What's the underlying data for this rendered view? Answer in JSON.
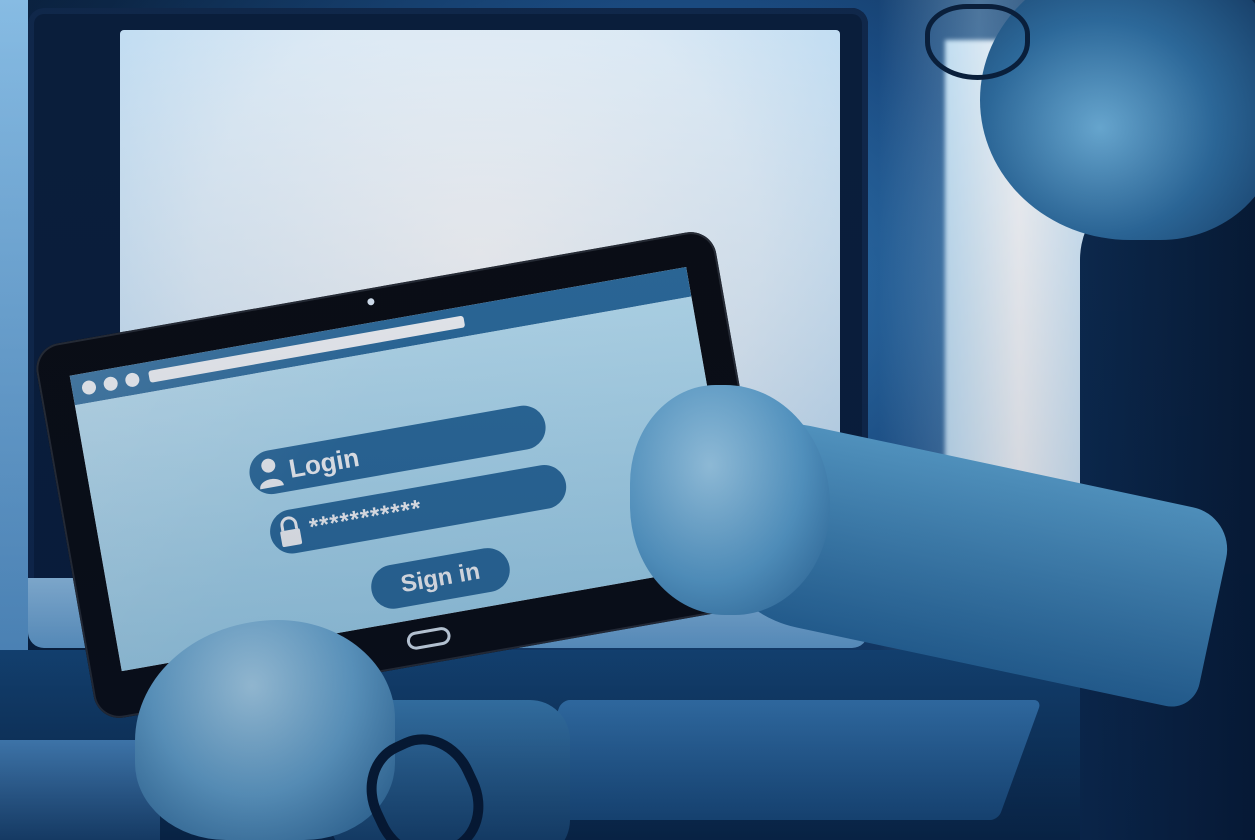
{
  "tablet": {
    "login_field": {
      "label": "Login",
      "icon": "user-icon"
    },
    "password_field": {
      "value": "***********",
      "icon": "lock-icon"
    },
    "sign_in_label": "Sign in",
    "window_dots": 3
  },
  "colors": {
    "ui_accent": "#2f6f9f",
    "screen_background": "#bfe6f7",
    "scene_tone": "#1c4f86"
  }
}
